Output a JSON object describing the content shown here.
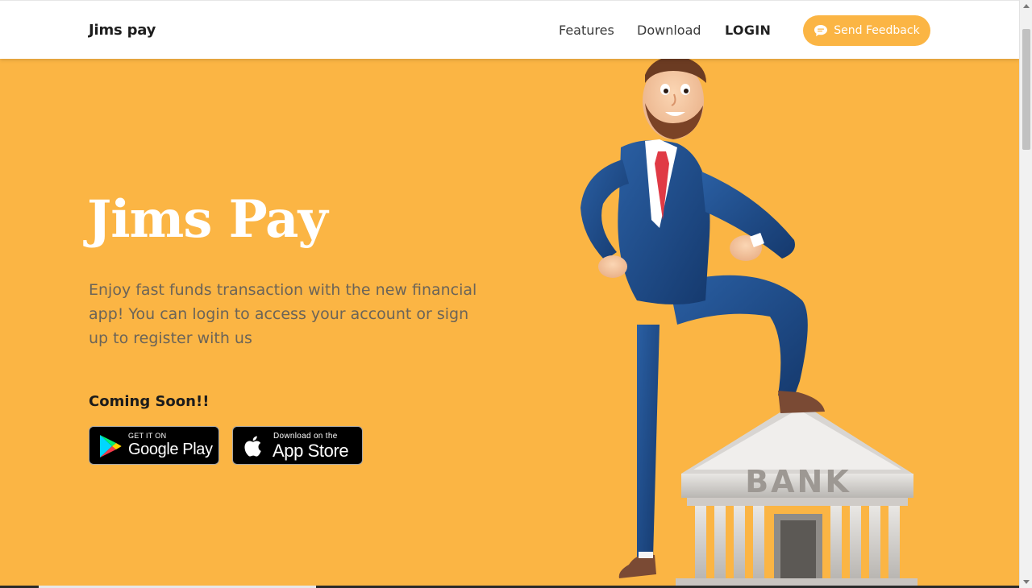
{
  "nav": {
    "brand": "Jims pay",
    "links": [
      "Features",
      "Download",
      "LOGIN"
    ],
    "feedback_label": "Send Feedback"
  },
  "hero": {
    "title": "Jims Pay",
    "description": "Enjoy fast funds transaction with the new financial app! You can login to access your account or sign up to register with us",
    "coming_soon": "Coming Soon!!",
    "google_play": {
      "small": "GET IT ON",
      "big": "Google Play"
    },
    "app_store": {
      "small": "Download on the",
      "big": "App Store"
    },
    "illustration_sign": "BANK"
  },
  "colors": {
    "hero_bg": "#fbb544",
    "accent": "#fbb544",
    "title": "#ffffff",
    "body_text": "#6b6458"
  },
  "icons": [
    "chat-bubble-icon",
    "google-play-icon",
    "apple-icon"
  ]
}
